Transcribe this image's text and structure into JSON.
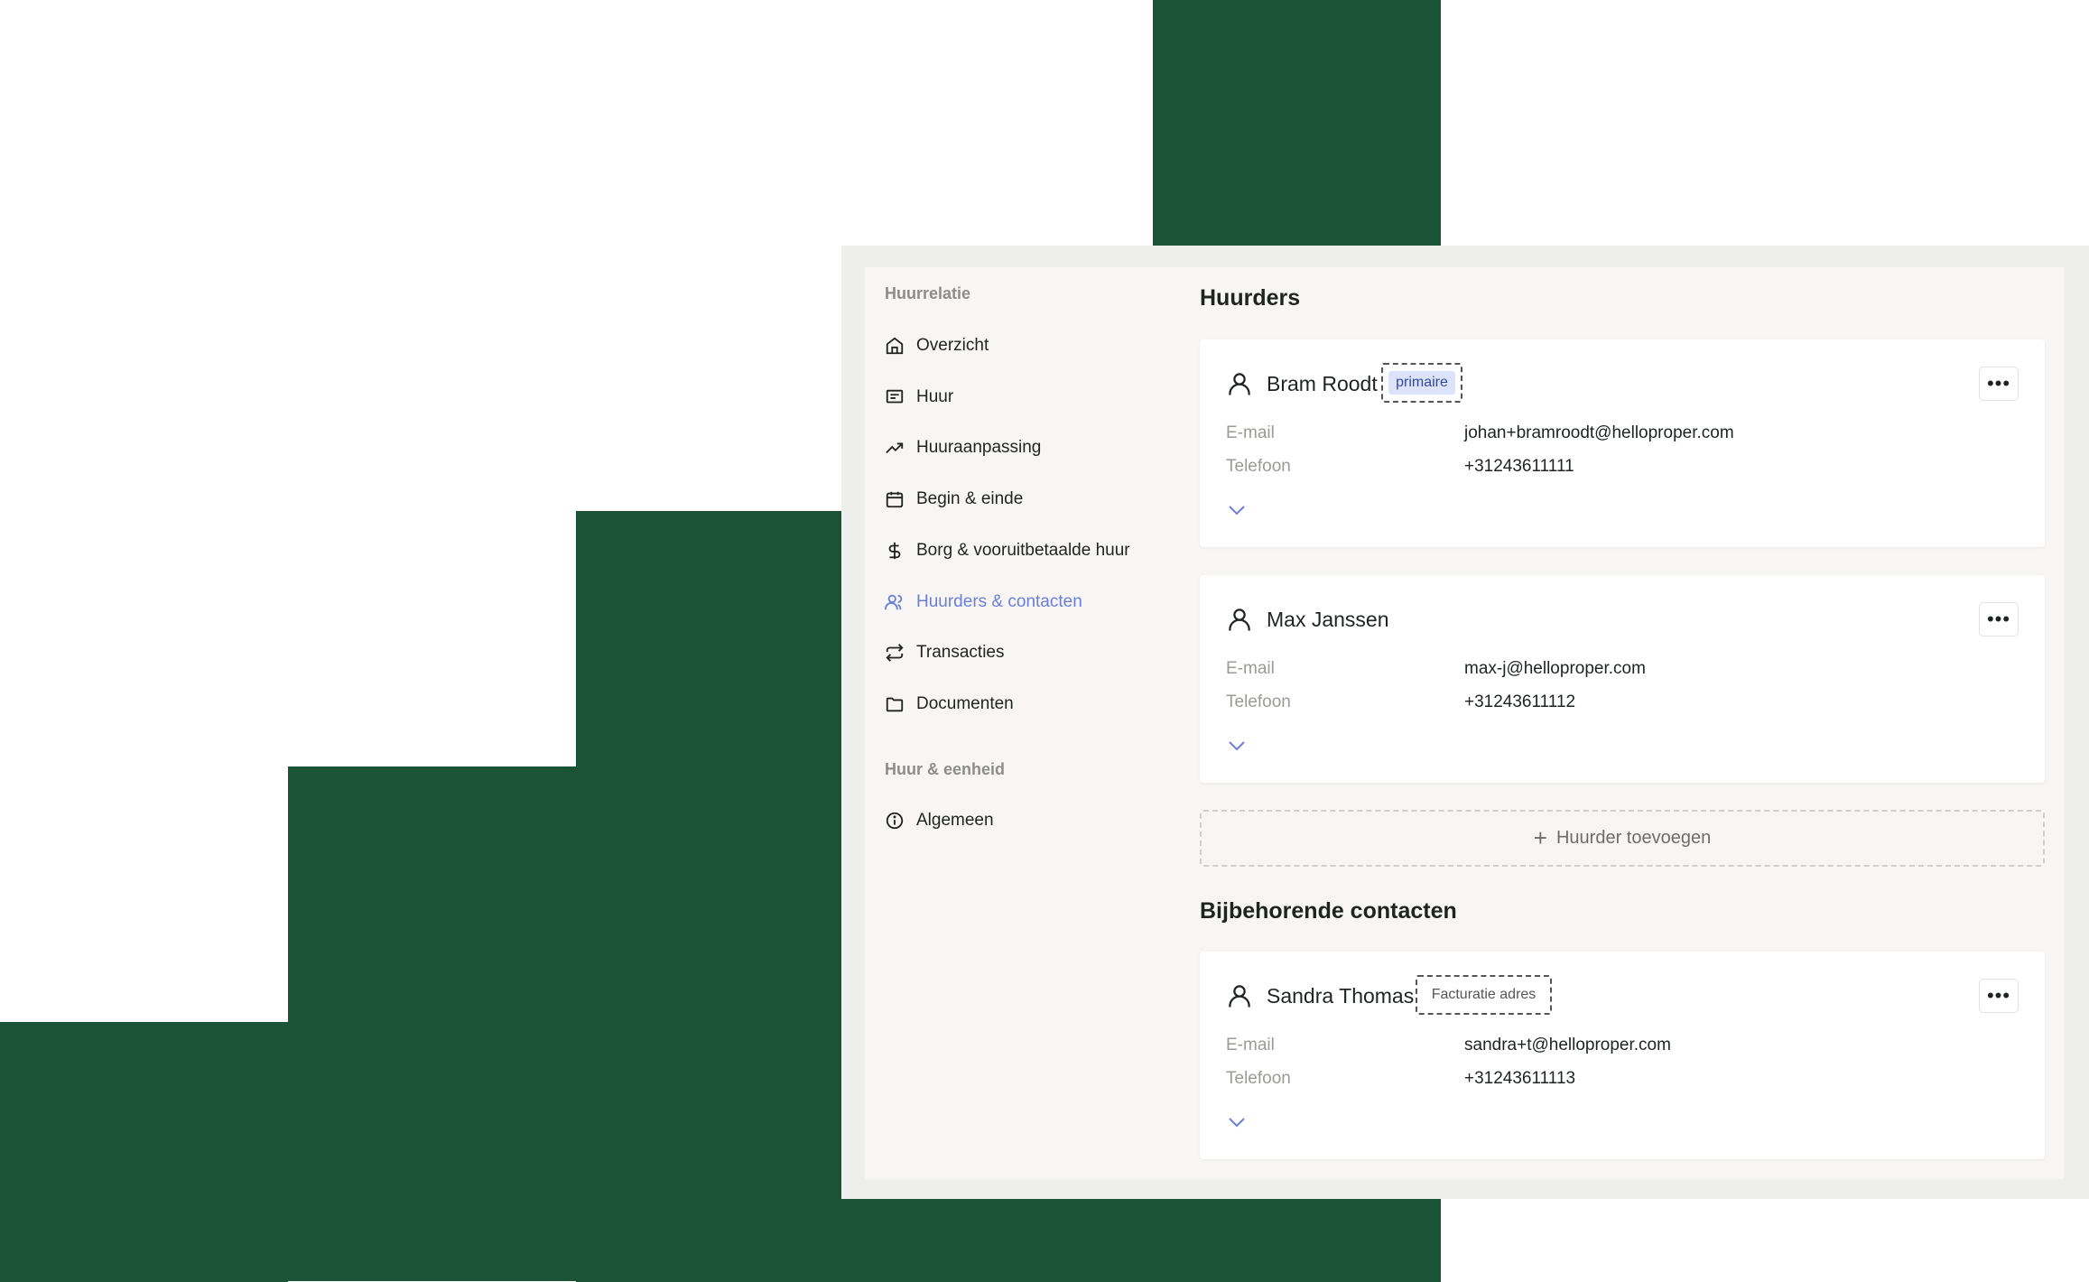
{
  "sidebar": {
    "section1": "Huurrelatie",
    "items": [
      {
        "label": "Overzicht",
        "icon": "home-icon"
      },
      {
        "label": "Huur",
        "icon": "message-icon"
      },
      {
        "label": "Huuraanpassing",
        "icon": "trending-up-icon"
      },
      {
        "label": "Begin & einde",
        "icon": "calendar-icon"
      },
      {
        "label": "Borg & vooruitbetaalde huur",
        "icon": "dollar-icon"
      },
      {
        "label": "Huurders & contacten",
        "icon": "users-icon",
        "active": true
      },
      {
        "label": "Transacties",
        "icon": "repeat-icon"
      },
      {
        "label": "Documenten",
        "icon": "folder-icon"
      }
    ],
    "section2": "Huur & eenheid",
    "items2": [
      {
        "label": "Algemeen",
        "icon": "info-icon"
      }
    ]
  },
  "main": {
    "tenants_title": "Huurders",
    "tenants": [
      {
        "name": "Bram Roodt",
        "badge": "primaire",
        "email_label": "E-mail",
        "email": "johan+bramroodt@helloproper.com",
        "phone_label": "Telefoon",
        "phone": "+31243611111"
      },
      {
        "name": "Max Janssen",
        "email_label": "E-mail",
        "email": "max-j@helloproper.com",
        "phone_label": "Telefoon",
        "phone": "+31243611112"
      }
    ],
    "add_tenant": "Huurder toevoegen",
    "contacts_title": "Bijbehorende contacten",
    "contacts": [
      {
        "name": "Sandra Thomas",
        "badge": "Facturatie adres",
        "email_label": "E-mail",
        "email": "sandra+t@helloproper.com",
        "phone_label": "Telefoon",
        "phone": "+31243611113"
      }
    ]
  },
  "colors": {
    "background_green": "#1a5335",
    "accent": "#6b7fd8",
    "badge_bg": "#dde3fb"
  }
}
